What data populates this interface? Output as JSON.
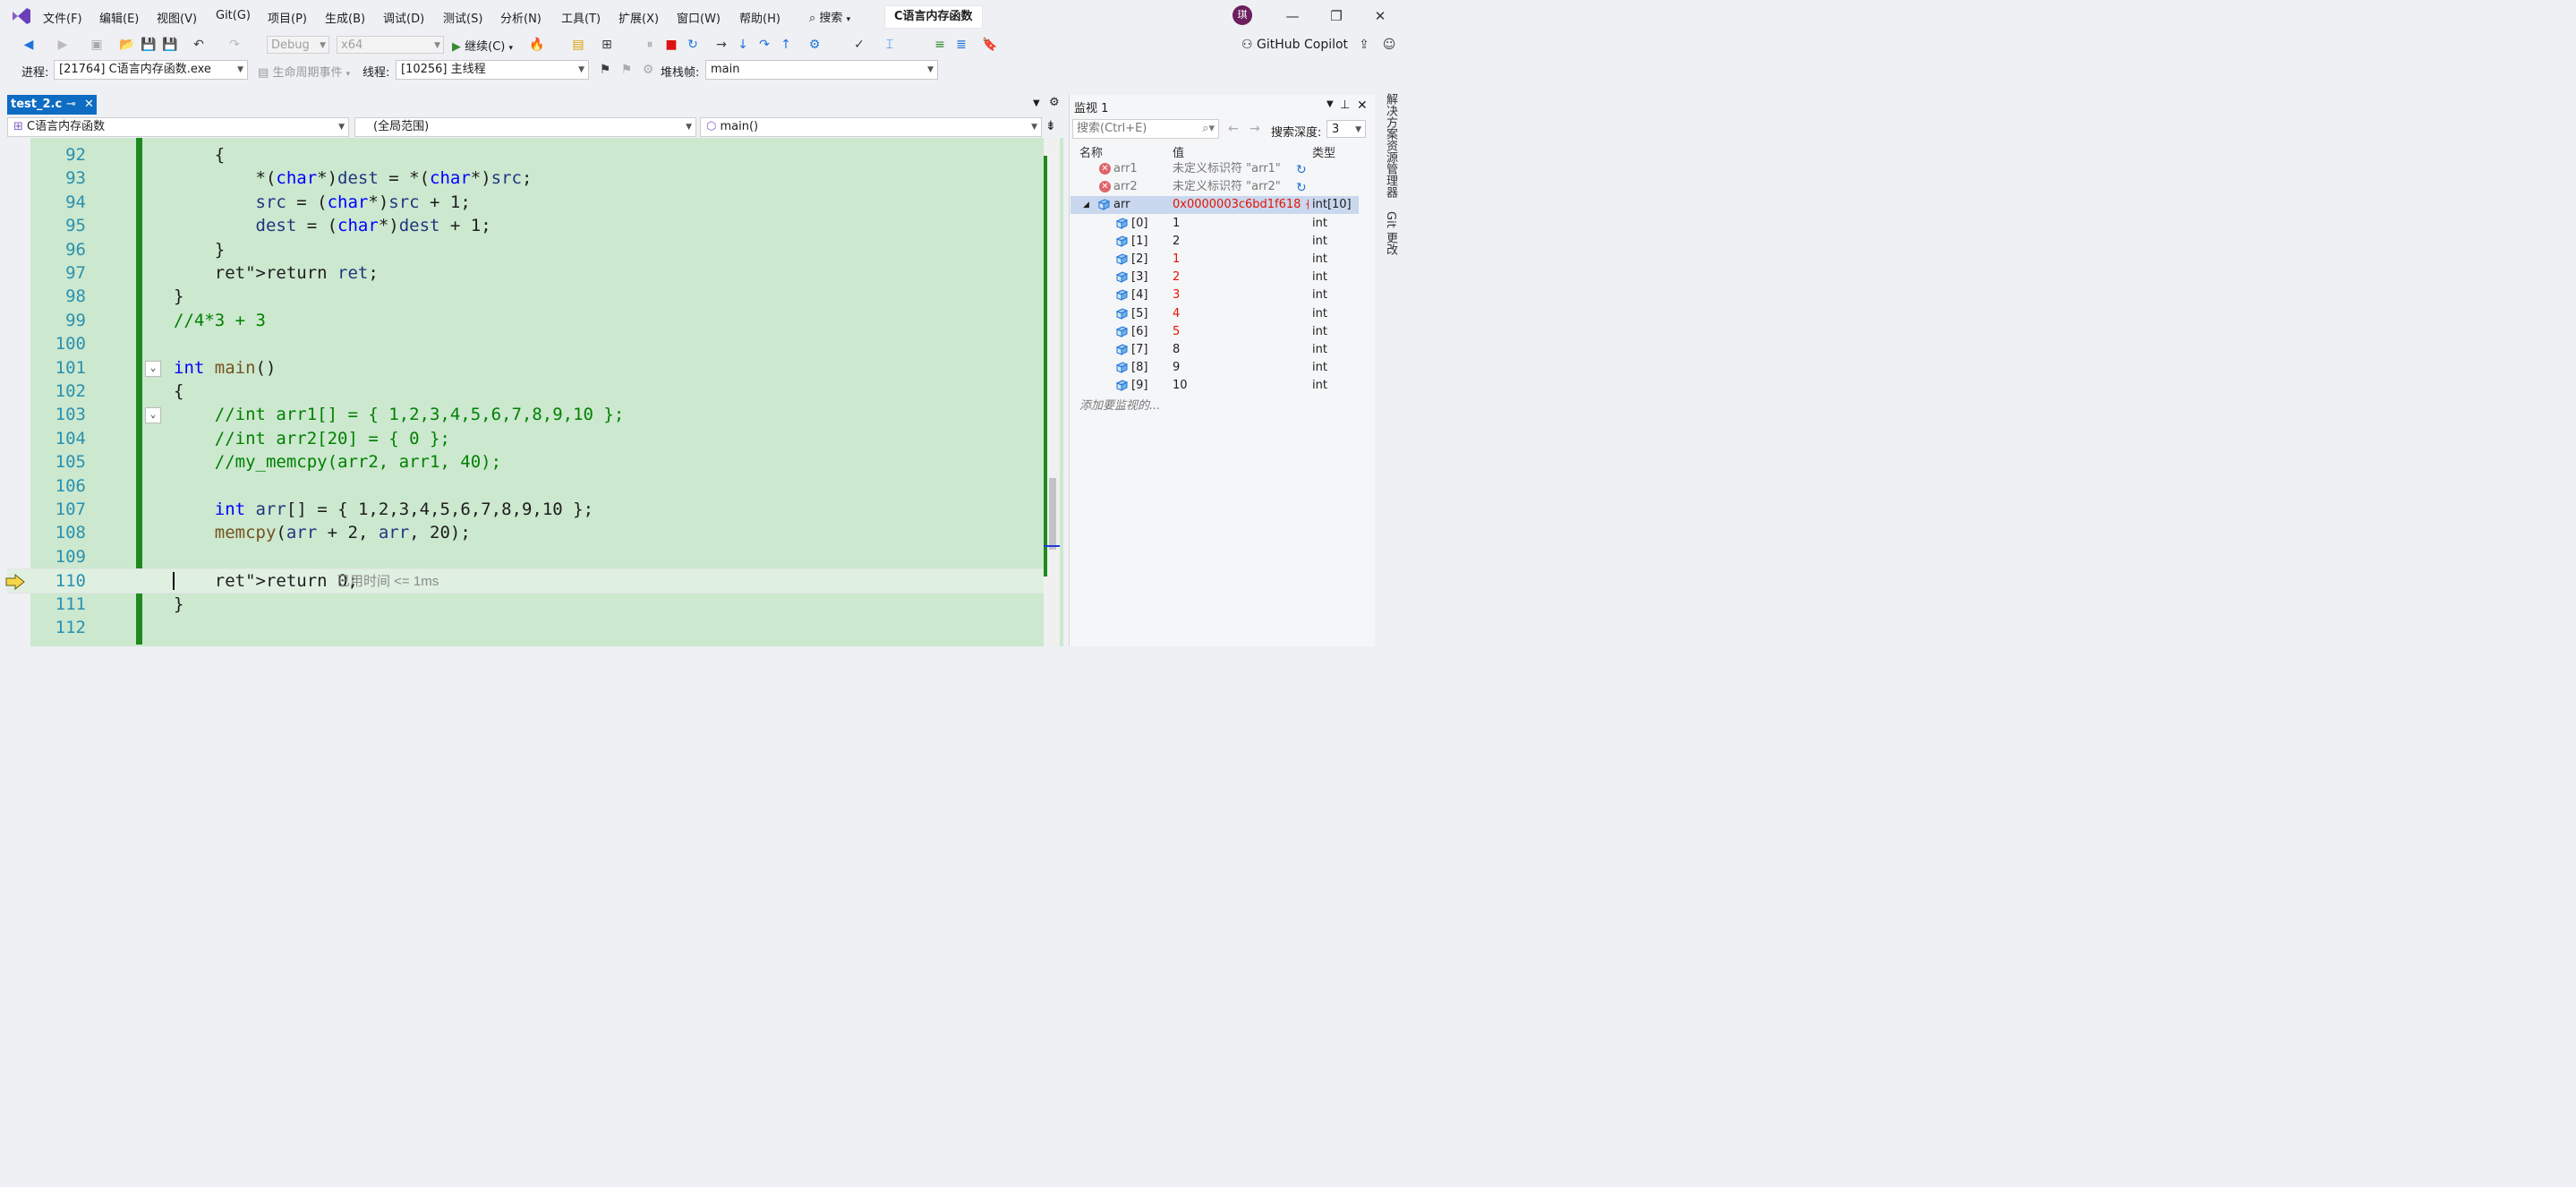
{
  "menu": [
    "文件(F)",
    "编辑(E)",
    "视图(V)",
    "Git(G)",
    "项目(P)",
    "生成(B)",
    "调试(D)",
    "测试(S)",
    "分析(N)",
    "工具(T)",
    "扩展(X)",
    "窗口(W)",
    "帮助(H)"
  ],
  "search_label": "搜索",
  "project_title": "C语言内存函数",
  "avatar_text": "琪",
  "toolbar": {
    "config": "Debug",
    "platform": "x64",
    "continue": "继续(C)",
    "copilot": "GitHub Copilot"
  },
  "debugbar": {
    "process_label": "进程:",
    "process_value": "[21764] C语言内存函数.exe",
    "lifecycle": "生命周期事件",
    "thread_label": "线程:",
    "thread_value": "[10256] 主线程",
    "stack_label": "堆栈帧:",
    "stack_value": "main"
  },
  "editor": {
    "tab": "test_2.c",
    "nav_project": "C语言内存函数",
    "nav_scope": "(全局范围)",
    "nav_function": "main()",
    "elapsed": "已用时间 <= 1ms",
    "lines": [
      {
        "n": "92",
        "t": "    {"
      },
      {
        "n": "93",
        "t": "        *(char*)dest = *(char*)src;"
      },
      {
        "n": "94",
        "t": "        src = (char*)src + 1;"
      },
      {
        "n": "95",
        "t": "        dest = (char*)dest + 1;"
      },
      {
        "n": "96",
        "t": "    }"
      },
      {
        "n": "97",
        "t": "    return ret;"
      },
      {
        "n": "98",
        "t": "}"
      },
      {
        "n": "99",
        "t": "//4*3 + 3"
      },
      {
        "n": "100",
        "t": ""
      },
      {
        "n": "101",
        "t": "int main()"
      },
      {
        "n": "102",
        "t": "{"
      },
      {
        "n": "103",
        "t": "    //int arr1[] = { 1,2,3,4,5,6,7,8,9,10 };"
      },
      {
        "n": "104",
        "t": "    //int arr2[20] = { 0 };"
      },
      {
        "n": "105",
        "t": "    //my_memcpy(arr2, arr1, 40);"
      },
      {
        "n": "106",
        "t": ""
      },
      {
        "n": "107",
        "t": "    int arr[] = { 1,2,3,4,5,6,7,8,9,10 };"
      },
      {
        "n": "108",
        "t": "    memcpy(arr + 2, arr, 20);"
      },
      {
        "n": "109",
        "t": ""
      },
      {
        "n": "110",
        "t": "    return 0;"
      },
      {
        "n": "111",
        "t": "}"
      },
      {
        "n": "112",
        "t": ""
      }
    ]
  },
  "watch": {
    "title": "监视 1",
    "search_placeholder": "搜索(Ctrl+E)",
    "depth_label": "搜索深度:",
    "depth_value": "3",
    "col_name": "名称",
    "col_value": "值",
    "col_type": "类型",
    "add_hint": "添加要监视的...",
    "rows": [
      {
        "name": "arr1",
        "value": "未定义标识符 \"arr1\"",
        "type": ""
      },
      {
        "name": "arr2",
        "value": "未定义标识符 \"arr2\"",
        "type": ""
      },
      {
        "name": "arr",
        "value": "0x0000003c6bd1f618 {...",
        "type": "int[10]"
      },
      {
        "name": "[0]",
        "value": "1",
        "type": "int"
      },
      {
        "name": "[1]",
        "value": "2",
        "type": "int"
      },
      {
        "name": "[2]",
        "value": "1",
        "type": "int"
      },
      {
        "name": "[3]",
        "value": "2",
        "type": "int"
      },
      {
        "name": "[4]",
        "value": "3",
        "type": "int"
      },
      {
        "name": "[5]",
        "value": "4",
        "type": "int"
      },
      {
        "name": "[6]",
        "value": "5",
        "type": "int"
      },
      {
        "name": "[7]",
        "value": "8",
        "type": "int"
      },
      {
        "name": "[8]",
        "value": "9",
        "type": "int"
      },
      {
        "name": "[9]",
        "value": "10",
        "type": "int"
      }
    ]
  },
  "side": {
    "solution_explorer": "解决方案资源管理器",
    "git_changes": "Git 更改"
  }
}
